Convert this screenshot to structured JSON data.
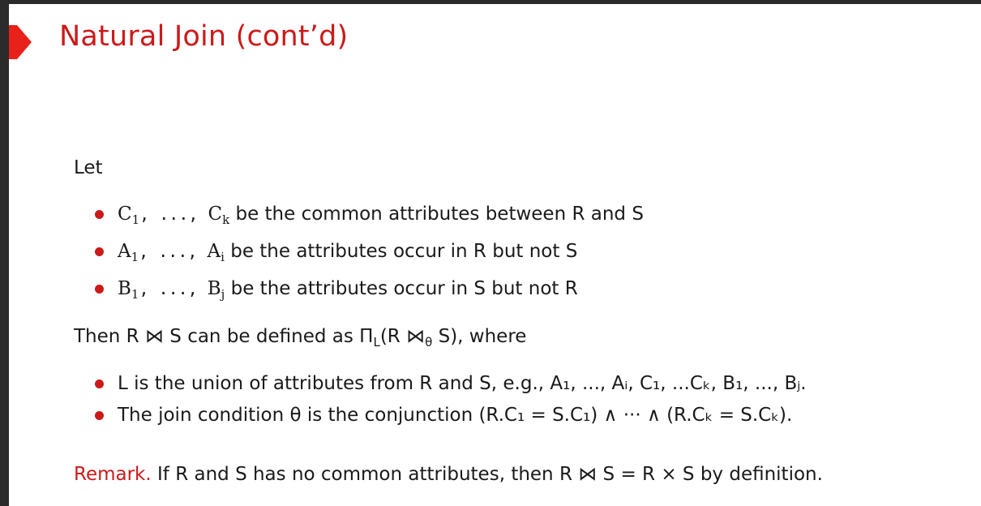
{
  "slide": {
    "title": "Natural Join (cont’d)",
    "let_label": "Let",
    "bullets_common": [
      {
        "pre": "C",
        "sub1": "1",
        "sep": ", ..., ",
        "end": "C",
        "sub2": "k",
        "text": " be the common attributes between R and S"
      },
      {
        "pre": "A",
        "sub1": "1",
        "sep": ", ..., ",
        "end": "A",
        "sub2": "i",
        "text": " be the attributes occur in R but not S"
      },
      {
        "pre": "B",
        "sub1": "1",
        "sep": ", ..., ",
        "end": "B",
        "sub2": "j",
        "text": " be the attributes occur in S but not R"
      }
    ],
    "then_line": {
      "prefix": "Then R",
      "join_symbol": "⋈",
      "mid": "S can be defined as Π",
      "pi_sub": "L",
      "paren_open": "(R",
      "theta_join_symbol": "⋈",
      "theta_sub": "θ",
      "suffix": "S), where"
    },
    "bullets_defs": [
      {
        "text": "L is the union of attributes from R and S, e.g., A₁, ..., Aᵢ, C₁, ...Cₖ, B₁, ..., Bⱼ."
      },
      {
        "text": "The join condition θ is the conjunction (R.C₁ = S.C₁) ∧ ··· ∧ (R.Cₖ = S.Cₖ)."
      }
    ],
    "remark": {
      "label": "Remark.",
      "text": " If R and S has no common attributes, then R ⋈ S = R × S by definition."
    },
    "colors": {
      "accent": "#cc1a1a",
      "text": "#1a1a1a",
      "frame": "#2b2b2b"
    },
    "icons": {
      "title_marker": "triangle-right-icon",
      "bullet": "bullet-dot-icon"
    }
  }
}
